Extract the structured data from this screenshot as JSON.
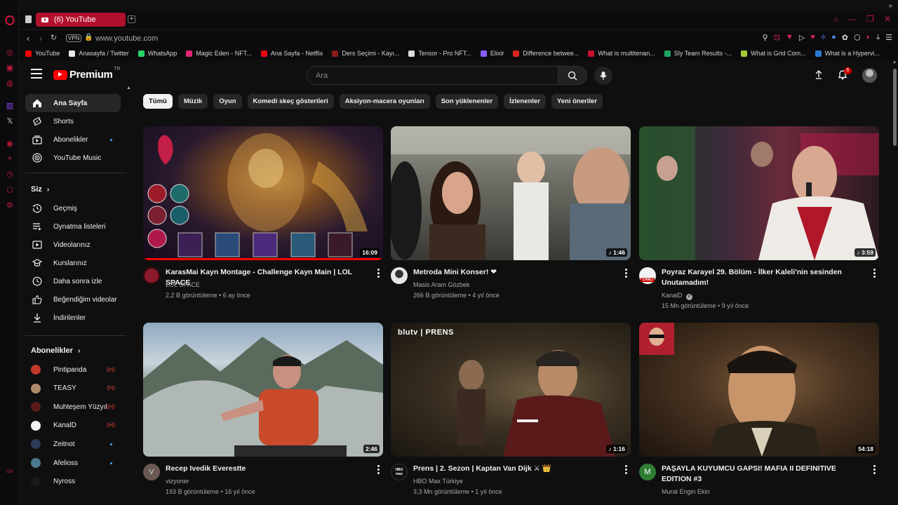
{
  "browser": {
    "tab_title": "(6) YouTube",
    "url": "www.youtube.com",
    "vpn_label": "VPN",
    "bookmarks": [
      {
        "label": "YouTube",
        "color": "#ff0000"
      },
      {
        "label": "Anasayfa / Twitter",
        "color": "#e7e7e7"
      },
      {
        "label": "WhatsApp",
        "color": "#25d366"
      },
      {
        "label": "Magic Eden - NFT...",
        "color": "#e42575"
      },
      {
        "label": "Ana Sayfa - Netflix",
        "color": "#e50914"
      },
      {
        "label": "Ders Seçimi - Kayı...",
        "color": "#8b1a1a"
      },
      {
        "label": "Tensor - Pro NFT...",
        "color": "#dddddd"
      },
      {
        "label": "Elixir",
        "color": "#8a5cf6"
      },
      {
        "label": "Difference betwee...",
        "color": "#d9251c"
      },
      {
        "label": "What is multitenan...",
        "color": "#c8102e"
      },
      {
        "label": "Sly Team Results -...",
        "color": "#1fa463"
      },
      {
        "label": "What is Grid Com...",
        "color": "#a8c93a"
      },
      {
        "label": "What is a Hypervi...",
        "color": "#2a7ad5"
      }
    ]
  },
  "masthead": {
    "logo_text": "Premium",
    "logo_region": "TR",
    "search_placeholder": "Ara",
    "notification_count": "6"
  },
  "sidebar": {
    "main": [
      {
        "label": "Ana Sayfa",
        "icon": "home-icon"
      },
      {
        "label": "Shorts",
        "icon": "shorts-icon"
      },
      {
        "label": "Abonelikler",
        "icon": "subscriptions-icon"
      },
      {
        "label": "YouTube Music",
        "icon": "music-icon"
      }
    ],
    "you_heading": "Siz",
    "you": [
      {
        "label": "Geçmiş",
        "icon": "history-icon"
      },
      {
        "label": "Oynatma listeleri",
        "icon": "playlists-icon"
      },
      {
        "label": "Videolarınız",
        "icon": "your-videos-icon"
      },
      {
        "label": "Kurslarınız",
        "icon": "courses-icon"
      },
      {
        "label": "Daha sonra izle",
        "icon": "watch-later-icon"
      },
      {
        "label": "Beğendiğim videolar",
        "icon": "liked-icon"
      },
      {
        "label": "İndirilenler",
        "icon": "downloads-icon"
      }
    ],
    "subs_heading": "Abonelikler",
    "subscriptions": [
      {
        "label": "Pintipanda",
        "status": "live",
        "color": "#c0392b"
      },
      {
        "label": "TEASY",
        "status": "live",
        "color": "#b08968"
      },
      {
        "label": "Muhteşem Yüzyıl",
        "status": "live",
        "color": "#5a1a1a"
      },
      {
        "label": "KanalD",
        "status": "live",
        "color": "#f1f1f1"
      },
      {
        "label": "Zeitnot",
        "status": "new",
        "color": "#2b3a55"
      },
      {
        "label": "Afelioss",
        "status": "new",
        "color": "#4a7a8c"
      },
      {
        "label": "Nyross",
        "status": "",
        "color": "#1a1a1a"
      }
    ]
  },
  "chips": [
    "Tümü",
    "Müzik",
    "Oyun",
    "Komedi skeç gösterileri",
    "Aksiyon-macera oyunları",
    "Son yüklenenler",
    "İzlenenler",
    "Yeni öneriler"
  ],
  "videos": [
    {
      "title": "KarasMai Kayn Montage -  Challenge Kayn Main | LOL SPACE",
      "channel": "LOL SPACE",
      "stats": "2,2 B görüntüleme • 6 ay önce",
      "duration": "16:09",
      "watched": 1.0,
      "avatar_color": "#8b1a2b"
    },
    {
      "title": "Metroda Mini Konser! ❤",
      "channel": "Masis Aram Gözbek",
      "stats": "266 B görüntüleme • 4 yıl önce",
      "duration": "♪ 1:46",
      "avatar_color": "#e6e6e6"
    },
    {
      "title": "Poyraz Karayel 29. Bölüm - İlker Kaleli'nin sesinden Unutamadım!",
      "channel": "KanalD",
      "verified": "✔",
      "stats": "15 Mn görüntüleme • 9 yıl önce",
      "duration": "♪ 3:59",
      "avatar_color": "#f1f1f1",
      "avatar_text": "CANLI"
    },
    {
      "title": "Recep Ivedik Everestte",
      "channel": "vizyoner",
      "stats": "193 B görüntüleme • 16 yıl önce",
      "duration": "2:46",
      "avatar_color": "#6b5a52",
      "avatar_text": "V"
    },
    {
      "title": "Prens | 2. Sezon | Kaptan Van Dijk ⚔ 👑",
      "channel": "HBO Max Türkiye",
      "stats": "3,3 Mn görüntüleme • 1 yıl önce",
      "duration": "♪ 1:16",
      "avatar_color": "#111111",
      "avatar_text": "HBO max",
      "thumb_caption": "blutv | PRENS"
    },
    {
      "title": "PAŞAYLA KUYUMCU GAPSI!   MAFIA II  DEFINITIVE EDITION #3",
      "channel": "Murat Engin Ekin",
      "stats": "",
      "duration": "54:18",
      "avatar_color": "#2e7d32",
      "avatar_text": "M"
    }
  ]
}
